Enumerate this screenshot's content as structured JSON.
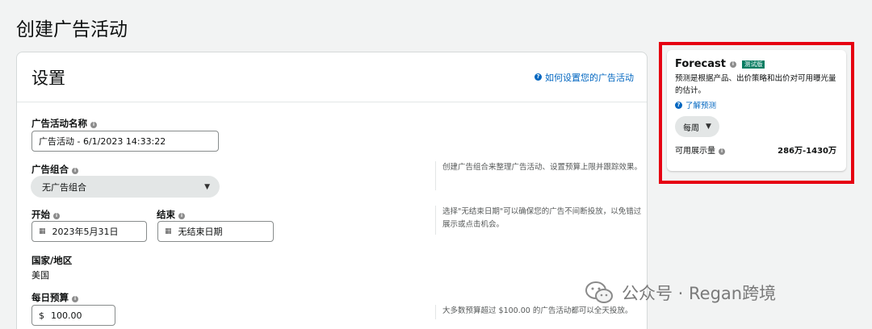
{
  "page": {
    "title": "创建广告活动"
  },
  "settings": {
    "title": "设置",
    "help_link": "如何设置您的广告活动",
    "campaign_name": {
      "label": "广告活动名称",
      "value": "广告活动 - 6/1/2023 14:33:22"
    },
    "portfolio": {
      "label": "广告组合",
      "selected": "无广告组合",
      "hint": "创建广告组合来整理广告活动、设置预算上限并跟踪效果。"
    },
    "start": {
      "label": "开始",
      "value": "2023年5月31日"
    },
    "end": {
      "label": "结束",
      "value": "无结束日期"
    },
    "date_hint": "选择\"无结束日期\"可以确保您的广告不间断投放，以免错过展示或点击机会。",
    "country": {
      "label": "国家/地区",
      "value": "美国"
    },
    "budget": {
      "label": "每日预算",
      "currency": "$",
      "value": "100.00",
      "hint": "大多数预算超过 $100.00 的广告活动都可以全天投放。"
    }
  },
  "forecast": {
    "title": "Forecast",
    "badge": "测试版",
    "description": "预测是根据产品、出价策略和出价对可用曝光量的估计。",
    "learn_link": "了解预测",
    "period": "每周",
    "metric_label": "可用展示量",
    "metric_value": "286万-1430万"
  },
  "watermark": {
    "text": "公众号 · Regan跨境"
  },
  "colors": {
    "link": "#0066c0",
    "highlight": "#e60012",
    "badge": "#067d62"
  }
}
